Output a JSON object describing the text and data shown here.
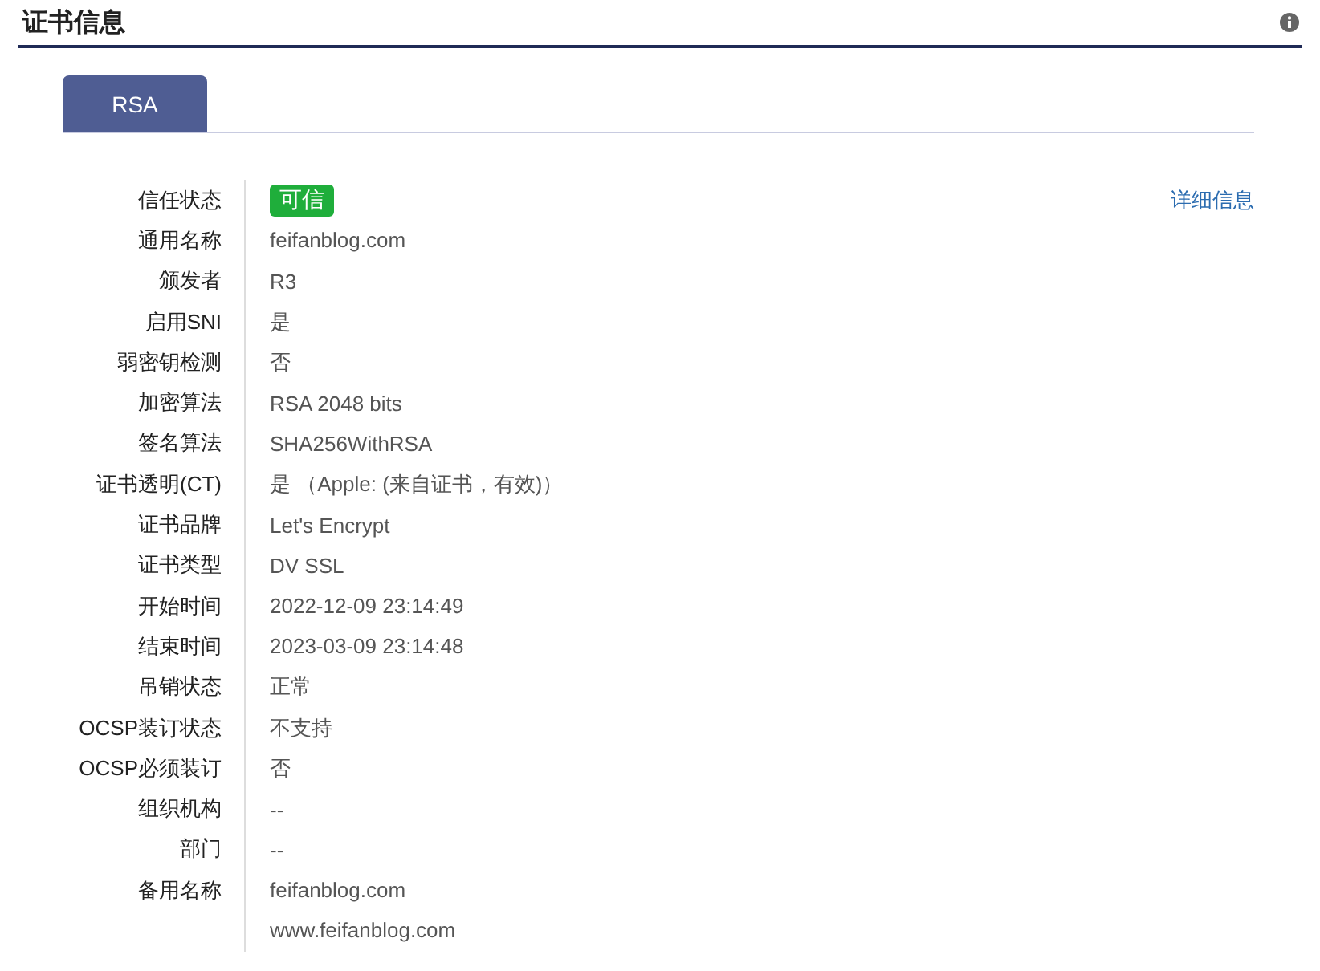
{
  "header": {
    "title": "证书信息"
  },
  "tabs": [
    {
      "label": "RSA",
      "selected": true
    }
  ],
  "detail_link": "详细信息",
  "rows": [
    {
      "label": "信任状态",
      "kind": "badge",
      "values": [
        "可信"
      ]
    },
    {
      "label": "通用名称",
      "kind": "text",
      "values": [
        "feifanblog.com"
      ]
    },
    {
      "label": "颁发者",
      "kind": "text",
      "values": [
        "R3"
      ]
    },
    {
      "label": "启用SNI",
      "kind": "text",
      "values": [
        "是"
      ]
    },
    {
      "label": "弱密钥检测",
      "kind": "text",
      "values": [
        "否"
      ]
    },
    {
      "label": "加密算法",
      "kind": "text",
      "values": [
        "RSA 2048 bits"
      ]
    },
    {
      "label": "签名算法",
      "kind": "text",
      "values": [
        "SHA256WithRSA"
      ]
    },
    {
      "label": "证书透明(CT)",
      "kind": "text",
      "values": [
        "是 （Apple: (来自证书，有效)）"
      ]
    },
    {
      "label": "证书品牌",
      "kind": "text",
      "values": [
        "Let's Encrypt"
      ]
    },
    {
      "label": "证书类型",
      "kind": "text",
      "values": [
        "DV SSL"
      ]
    },
    {
      "label": "开始时间",
      "kind": "text",
      "values": [
        "2022-12-09 23:14:49"
      ]
    },
    {
      "label": "结束时间",
      "kind": "text",
      "values": [
        "2023-03-09 23:14:48"
      ]
    },
    {
      "label": "吊销状态",
      "kind": "text",
      "values": [
        "正常"
      ]
    },
    {
      "label": "OCSP装订状态",
      "kind": "text",
      "values": [
        "不支持"
      ]
    },
    {
      "label": "OCSP必须装订",
      "kind": "text",
      "values": [
        "否"
      ]
    },
    {
      "label": "组织机构",
      "kind": "text",
      "values": [
        "--"
      ]
    },
    {
      "label": "部门",
      "kind": "text",
      "values": [
        "--"
      ]
    },
    {
      "label": "备用名称",
      "kind": "text",
      "values": [
        "feifanblog.com",
        "www.feifanblog.com"
      ]
    }
  ]
}
